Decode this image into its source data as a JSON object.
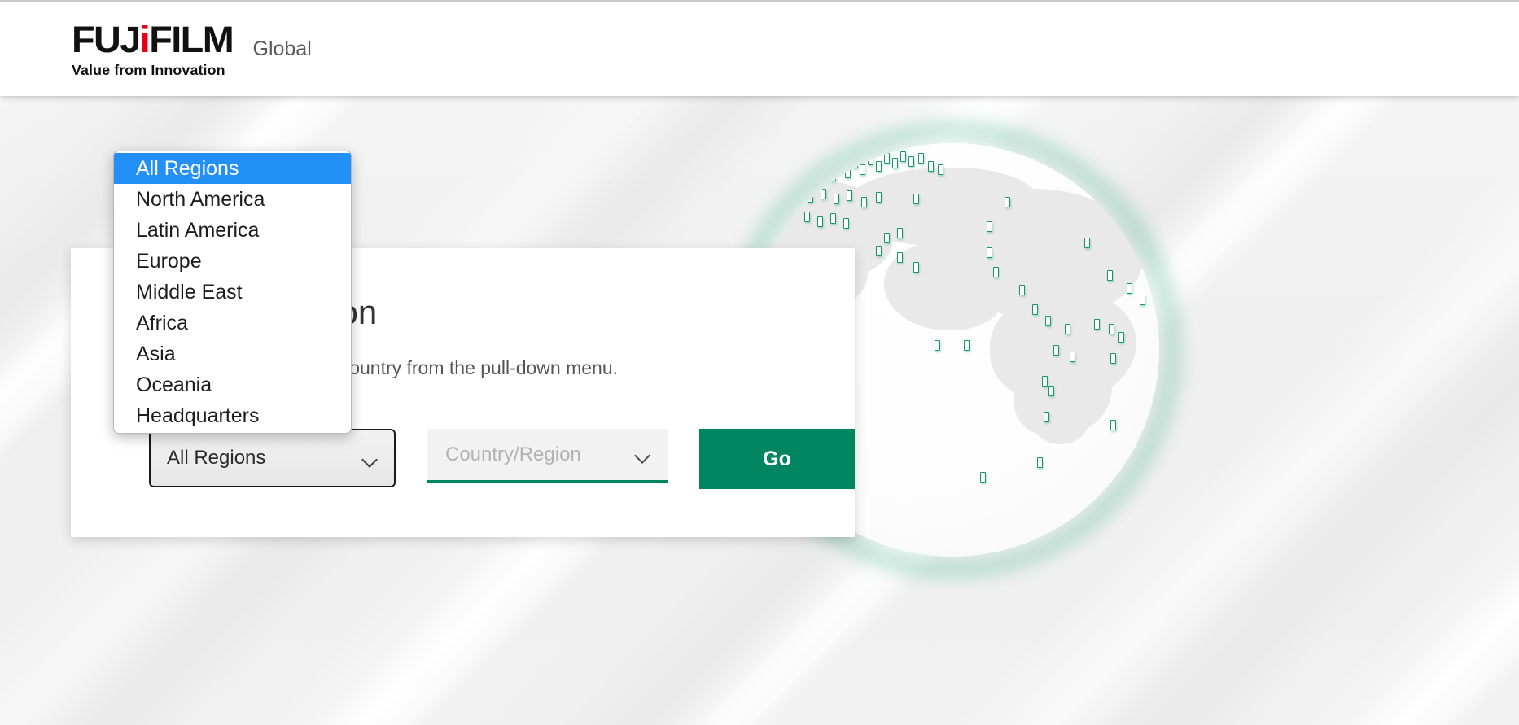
{
  "header": {
    "logo": {
      "text_main": "FUJ",
      "text_accent": "i",
      "text_tail": "FILM",
      "tagline": "Value from Innovation"
    },
    "global_label": "Global"
  },
  "card": {
    "title": "Select a region",
    "subtitle": "Please select a region/country from the pull-down menu.",
    "region_select": {
      "value": "All Regions",
      "icon": "chevron-down-icon"
    },
    "country_select": {
      "placeholder": "Country/Region",
      "value": "",
      "icon": "chevron-down-icon"
    },
    "go_button": {
      "label": "Go"
    }
  },
  "dropdown": {
    "open": true,
    "selected_index": 0,
    "options": [
      "All Regions",
      "North America",
      "Latin America",
      "Europe",
      "Middle East",
      "Africa",
      "Asia",
      "Oceania",
      "Headquarters"
    ]
  },
  "colors": {
    "brand_green": "#008561",
    "brand_red": "#e60012",
    "highlight_blue": "#2390f7",
    "page_bg": "#f1f1f1",
    "header_bg": "#ffffff"
  },
  "globe": {
    "alt": "world-globe-illustration"
  }
}
